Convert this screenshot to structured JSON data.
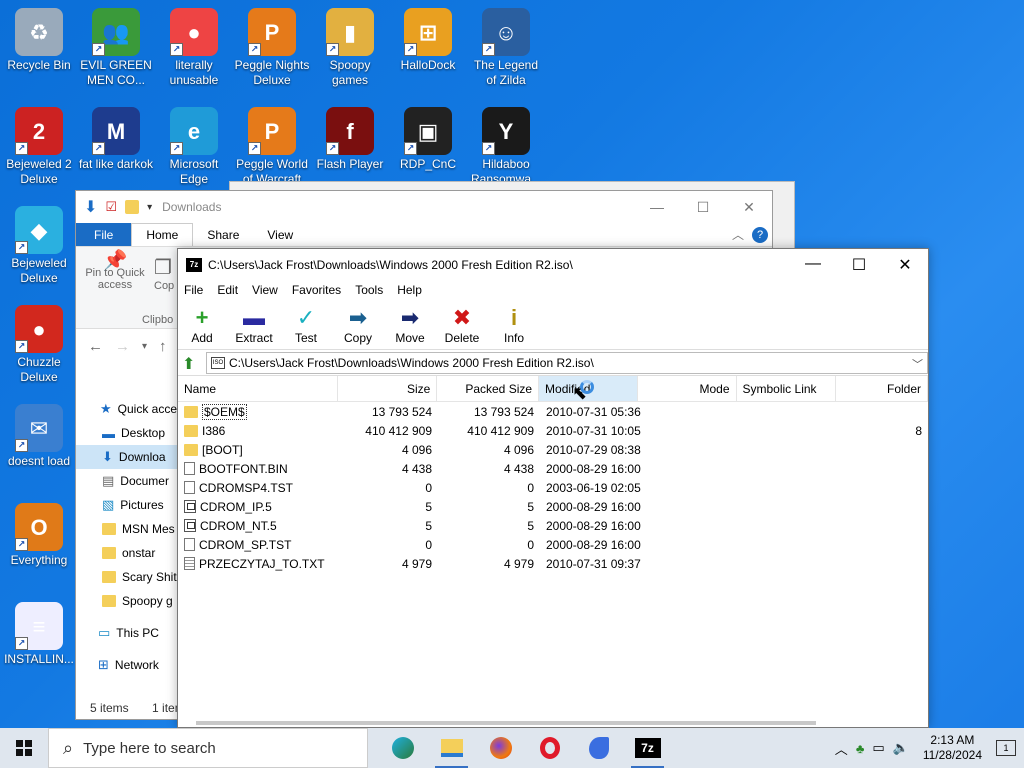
{
  "desktop": {
    "icons": [
      {
        "label": "Recycle Bin",
        "glyph": "♻",
        "color": "#9ab"
      },
      {
        "label": "EVIL GREEN MEN CO...",
        "glyph": "👥",
        "color": "#3a9a3a"
      },
      {
        "label": "literally unusable",
        "glyph": "●",
        "color": "#e44"
      },
      {
        "label": "Peggle Nights Deluxe",
        "glyph": "P",
        "color": "#e57a1a"
      },
      {
        "label": "Spoopy games",
        "glyph": "▮",
        "color": "#e2b040"
      },
      {
        "label": "HalloDock",
        "glyph": "⊞",
        "color": "#e9a020"
      },
      {
        "label": "The Legend of Zilda",
        "glyph": "☺",
        "color": "#2a5fa0"
      },
      {
        "label": "Bejeweled 2 Deluxe",
        "glyph": "2",
        "color": "#c22"
      },
      {
        "label": "fat like darkok",
        "glyph": "M",
        "color": "#1e3c8e"
      },
      {
        "label": "Microsoft Edge",
        "glyph": "e",
        "color": "#1f9bd8"
      },
      {
        "label": "Peggle World of Warcraft",
        "glyph": "P",
        "color": "#e57a1a"
      },
      {
        "label": "Flash Player",
        "glyph": "f",
        "color": "#7a0f0f"
      },
      {
        "label": "RDP_CnC",
        "glyph": "▣",
        "color": "#222"
      },
      {
        "label": "Hildaboo Ransomwa...",
        "glyph": "Y",
        "color": "#1a1a1a"
      },
      {
        "label": "Bejeweled Deluxe",
        "glyph": "◆",
        "color": "#2ab0e0"
      },
      {
        "label": "Chuzzle Deluxe",
        "glyph": "●",
        "color": "#d2281e"
      },
      {
        "label": "doesnt load",
        "glyph": "✉",
        "color": "#3a7fd0"
      },
      {
        "label": "Everything",
        "glyph": "O",
        "color": "#e07a18"
      },
      {
        "label": "INSTALLIN...",
        "glyph": "≡",
        "color": "#eef"
      }
    ]
  },
  "explorer": {
    "title": "Downloads",
    "tabs": {
      "file": "File",
      "home": "Home",
      "share": "Share",
      "view": "View"
    },
    "ribbon": {
      "pin": "Pin to Quick access",
      "copy": "Cop",
      "clipboard": "Clipbo"
    },
    "tree": [
      {
        "label": "Quick acce",
        "kind": "star"
      },
      {
        "label": "Desktop",
        "kind": "desk"
      },
      {
        "label": "Downloa",
        "kind": "down"
      },
      {
        "label": "Documer",
        "kind": "doc"
      },
      {
        "label": "Pictures",
        "kind": "pic"
      },
      {
        "label": "MSN Mes",
        "kind": "folder"
      },
      {
        "label": "onstar",
        "kind": "folder"
      },
      {
        "label": "Scary Shit",
        "kind": "folder"
      },
      {
        "label": "Spoopy g",
        "kind": "folder"
      },
      {
        "label": "This PC",
        "kind": "pc"
      },
      {
        "label": "Network",
        "kind": "net"
      }
    ],
    "status": "5 items",
    "status2": "1 item"
  },
  "zip": {
    "title": "C:\\Users\\Jack Frost\\Downloads\\Windows 2000 Fresh Edition R2.iso\\",
    "logo": "7z",
    "menu": [
      "File",
      "Edit",
      "View",
      "Favorites",
      "Tools",
      "Help"
    ],
    "tools": [
      {
        "label": "Add",
        "glyph": "+",
        "color": "#2aa02a"
      },
      {
        "label": "Extract",
        "glyph": "▬",
        "color": "#2a2aa0"
      },
      {
        "label": "Test",
        "glyph": "✓",
        "color": "#1ab0c0"
      },
      {
        "label": "Copy",
        "glyph": "➡",
        "color": "#1a6090"
      },
      {
        "label": "Move",
        "glyph": "➡",
        "color": "#1a2a70"
      },
      {
        "label": "Delete",
        "glyph": "✖",
        "color": "#d01818"
      },
      {
        "label": "Info",
        "glyph": "i",
        "color": "#b09010"
      }
    ],
    "address": "C:\\Users\\Jack Frost\\Downloads\\Windows 2000 Fresh Edition R2.iso\\",
    "columns": {
      "name": "Name",
      "size": "Size",
      "packed": "Packed Size",
      "modified": "Modified",
      "mode": "Mode",
      "symlink": "Symbolic Link",
      "folders": "Folder"
    },
    "rows": [
      {
        "name": "$OEM$",
        "size": "13 793 524",
        "packed": "13 793 524",
        "modified": "2010-07-31 05:36",
        "folders": "",
        "kind": "folder"
      },
      {
        "name": "I386",
        "size": "410 412 909",
        "packed": "410 412 909",
        "modified": "2010-07-31 10:05",
        "folders": "8",
        "kind": "folder"
      },
      {
        "name": "[BOOT]",
        "size": "4 096",
        "packed": "4 096",
        "modified": "2010-07-29 08:38",
        "folders": "",
        "kind": "folder"
      },
      {
        "name": "BOOTFONT.BIN",
        "size": "4 438",
        "packed": "4 438",
        "modified": "2000-08-29 16:00",
        "folders": "",
        "kind": "file"
      },
      {
        "name": "CDROMSP4.TST",
        "size": "0",
        "packed": "0",
        "modified": "2003-06-19 02:05",
        "folders": "",
        "kind": "file"
      },
      {
        "name": "CDROM_IP.5",
        "size": "5",
        "packed": "5",
        "modified": "2000-08-29 16:00",
        "folders": "",
        "kind": "sys"
      },
      {
        "name": "CDROM_NT.5",
        "size": "5",
        "packed": "5",
        "modified": "2000-08-29 16:00",
        "folders": "",
        "kind": "sys"
      },
      {
        "name": "CDROM_SP.TST",
        "size": "0",
        "packed": "0",
        "modified": "2000-08-29 16:00",
        "folders": "",
        "kind": "file"
      },
      {
        "name": "PRZECZYTAJ_TO.TXT",
        "size": "4 979",
        "packed": "4 979",
        "modified": "2010-07-31 09:37",
        "folders": "",
        "kind": "txt"
      }
    ]
  },
  "taskbar": {
    "search_placeholder": "Type here to search",
    "apps": [
      "edge",
      "explorer",
      "firefox",
      "opera",
      "bird",
      "7z"
    ],
    "app_7z_label": "7z",
    "time": "2:13 AM",
    "date": "11/28/2024",
    "notif_count": "1"
  }
}
